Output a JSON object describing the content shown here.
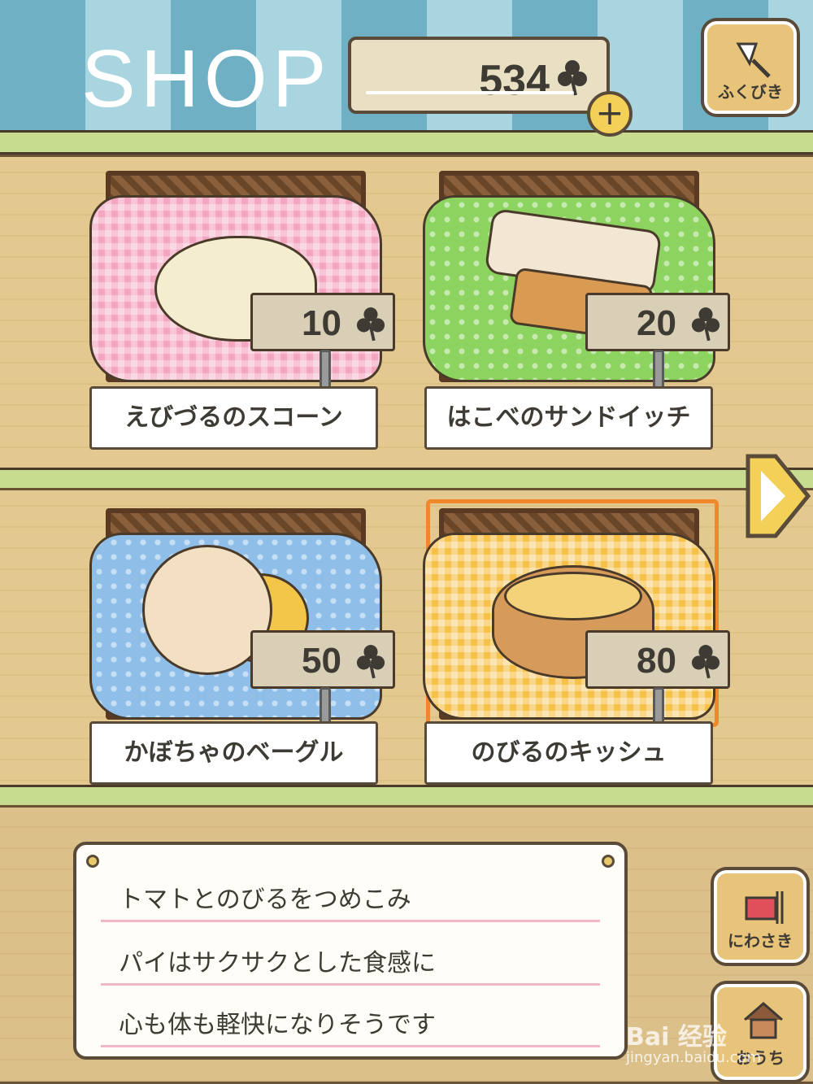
{
  "header": {
    "title": "SHOP",
    "coins": "534",
    "plus_label": "+",
    "lottery_label": "ふくびき"
  },
  "items": [
    {
      "name": "えびづるのスコーン",
      "price": "10",
      "cloth_color": "#f4a6c0",
      "cloth_pattern": "check",
      "food": "scone"
    },
    {
      "name": "はこべのサンドイッチ",
      "price": "20",
      "cloth_color": "#8cd35f",
      "cloth_pattern": "dots",
      "food": "sandwich"
    },
    {
      "name": "かぼちゃのベーグル",
      "price": "50",
      "cloth_color": "#8fbfe8",
      "cloth_pattern": "dots",
      "food": "bagel"
    },
    {
      "name": "のびるのキッシュ",
      "price": "80",
      "cloth_color": "#f7c04a",
      "cloth_pattern": "check",
      "food": "quiche",
      "selected": true
    }
  ],
  "description": {
    "lines": [
      "トマトとのびるをつめこみ",
      "パイはサクサクとした食感に",
      "心も体も軽快になりそうです"
    ]
  },
  "side_buttons": {
    "garden_label": "にわさき",
    "home_label": "おうち"
  },
  "watermark": {
    "brand": "Bai 经验",
    "url": "jingyan.baidu.com"
  }
}
